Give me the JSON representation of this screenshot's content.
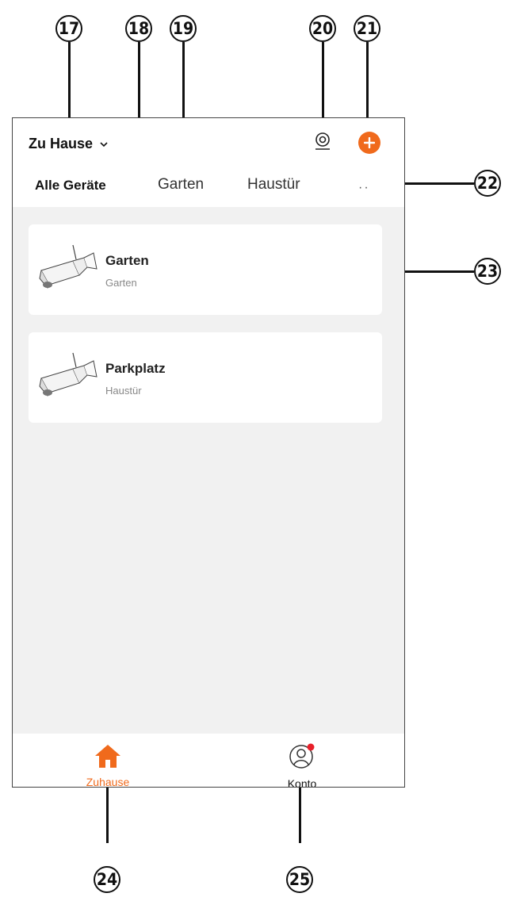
{
  "callouts": {
    "c17": "17",
    "c18": "18",
    "c19": "19",
    "c20": "20",
    "c21": "21",
    "c22": "22",
    "c23": "23",
    "c24": "24",
    "c25": "25"
  },
  "header": {
    "home_label": "Zu Hause",
    "icons": [
      "chevron-down-icon",
      "camera-icon",
      "plus-icon"
    ]
  },
  "tabs": [
    {
      "label": "Alle Geräte",
      "active": true
    },
    {
      "label": "Garten",
      "active": false
    },
    {
      "label": "Haustür",
      "active": false
    }
  ],
  "more_label": "··",
  "devices": [
    {
      "name": "Garten",
      "room": "Garten",
      "icon": "outdoor-camera-icon"
    },
    {
      "name": "Parkplatz",
      "room": "Haustür",
      "icon": "outdoor-camera-icon"
    }
  ],
  "nav": {
    "home_label": "Zuhause",
    "account_label": "Konto",
    "colors": {
      "accent": "#f06a1c",
      "badge": "#e8202a"
    }
  }
}
